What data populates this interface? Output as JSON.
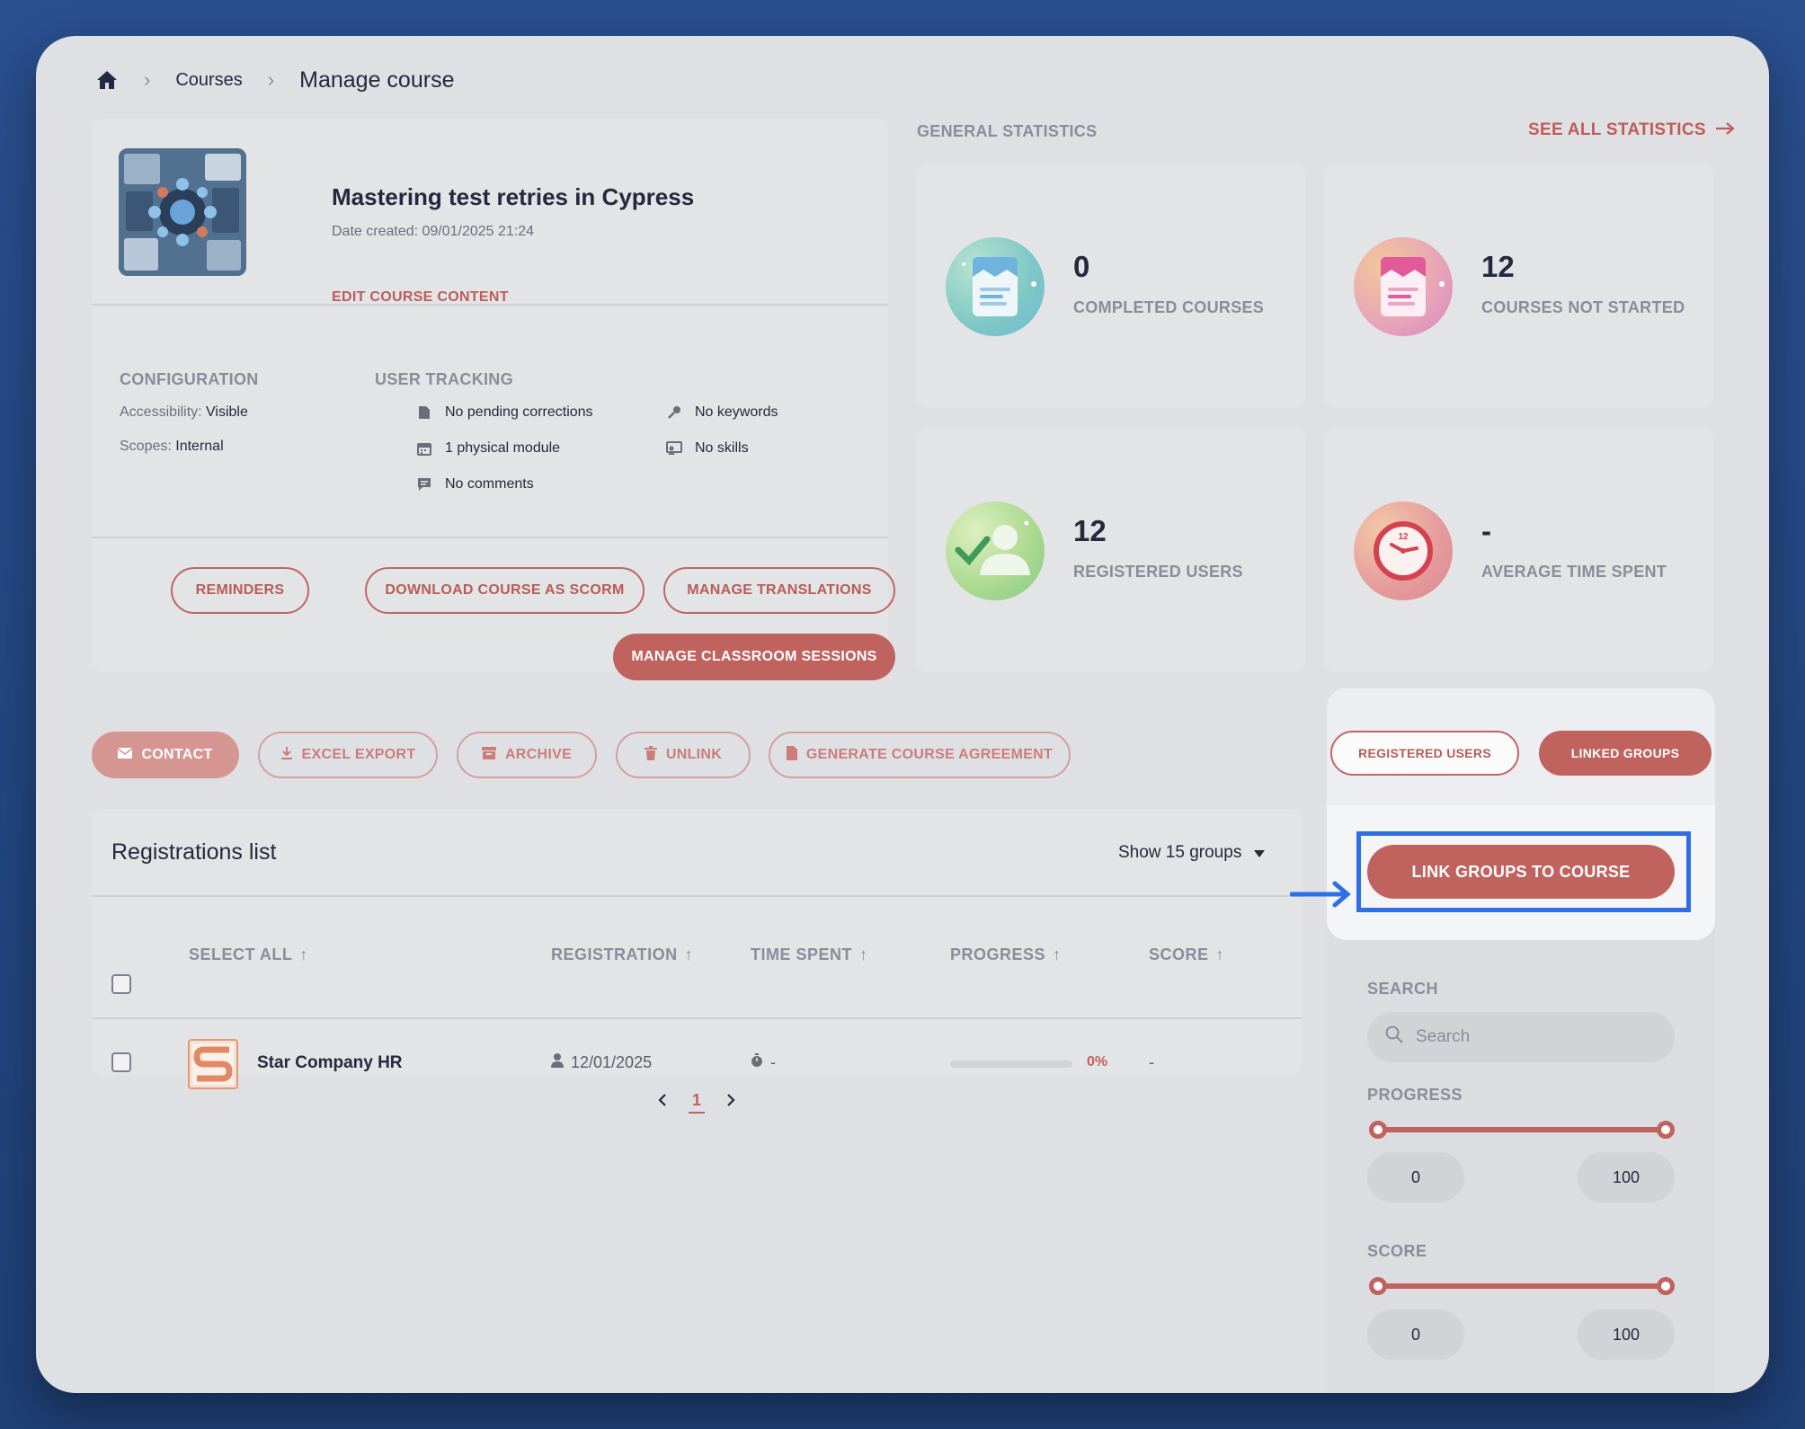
{
  "breadcrumb": {
    "home_icon": "home-icon",
    "courses": "Courses",
    "current": "Manage course"
  },
  "course": {
    "title": "Mastering test retries in Cypress",
    "date_created": "Date created: 09/01/2025 21:24",
    "edit_label": "EDIT COURSE CONTENT"
  },
  "configuration": {
    "heading": "CONFIGURATION",
    "accessibility_key": "Accessibility:",
    "accessibility_value": "Visible",
    "scopes_key": "Scopes:",
    "scopes_value": "Internal"
  },
  "tracking": {
    "heading": "USER TRACKING",
    "pending": "No pending corrections",
    "physical": "1 physical module",
    "comments": "No comments",
    "keywords": "No keywords",
    "skills": "No skills"
  },
  "card_actions": {
    "reminders": "REMINDERS",
    "scorm": "DOWNLOAD COURSE AS SCORM",
    "translations": "MANAGE TRANSLATIONS",
    "classroom": "MANAGE CLASSROOM SESSIONS"
  },
  "stats": {
    "title": "GENERAL STATISTICS",
    "see_all": "SEE ALL STATISTICS",
    "completed_value": "0",
    "completed_label": "COMPLETED COURSES",
    "not_started_value": "12",
    "not_started_label": "COURSES NOT STARTED",
    "registered_value": "12",
    "registered_label": "REGISTERED USERS",
    "avg_time_value": "-",
    "avg_time_label": "AVERAGE TIME SPENT"
  },
  "toolbar": {
    "contact": "CONTACT",
    "excel": "EXCEL EXPORT",
    "archive": "ARCHIVE",
    "unlink": "UNLINK",
    "agreement": "GENERATE COURSE AGREEMENT"
  },
  "list": {
    "title": "Registrations list",
    "show": "Show 15 groups",
    "columns": {
      "select_all": "SELECT ALL",
      "registration": "REGISTRATION",
      "time_spent": "TIME SPENT",
      "progress": "PROGRESS",
      "score": "SCORE"
    },
    "rows": [
      {
        "name": "Star Company HR",
        "registration": "12/01/2025",
        "time_spent": "-",
        "progress_value": 0,
        "progress_label": "0%",
        "score": "-"
      }
    ],
    "page": "1"
  },
  "right_panel": {
    "tab_registered": "REGISTERED USERS",
    "tab_linked": "LINKED GROUPS",
    "link_button": "LINK GROUPS TO COURSE",
    "search_label": "SEARCH",
    "search_placeholder": "Search",
    "progress_label": "PROGRESS",
    "progress_min": "0",
    "progress_max": "100",
    "score_label": "SCORE",
    "score_min": "0",
    "score_max": "100"
  },
  "colors": {
    "accent": "#c0625e",
    "highlight": "#2f6fe3",
    "background": "#23488a"
  }
}
